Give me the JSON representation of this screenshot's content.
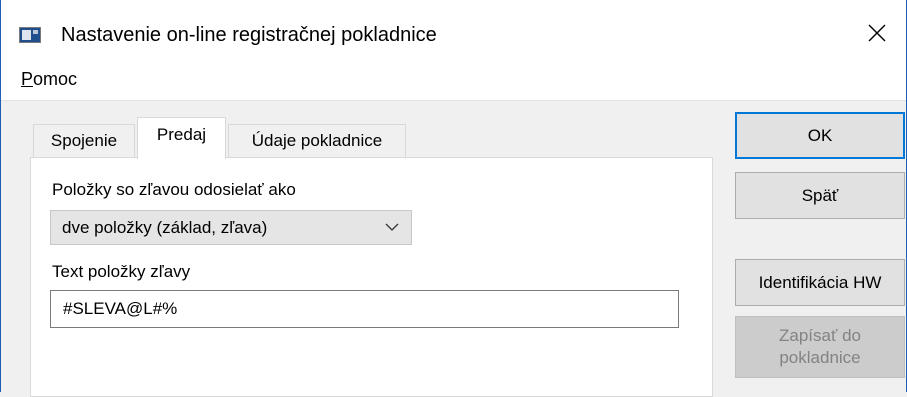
{
  "window": {
    "title": "Nastavenie on-line registračnej pokladnice"
  },
  "menu": {
    "items": [
      {
        "mnemonic": "P",
        "rest": "omoc"
      }
    ]
  },
  "tabs": [
    {
      "label": "Spojenie",
      "selected": false
    },
    {
      "label": "Predaj",
      "selected": true
    },
    {
      "label": "Údaje pokladnice",
      "selected": false
    }
  ],
  "panel": {
    "discount_mode_label": "Položky so zľavou odosielať ako",
    "discount_mode_value": "dve položky (základ, zľava)",
    "discount_text_label": "Text položky zľavy",
    "discount_text_value": "#SLEVA@L#%"
  },
  "buttons": {
    "ok": "OK",
    "back": "Späť",
    "identify_hw": "Identifikácia HW",
    "write_to_register": "Zapísať do\npokladnice"
  },
  "colors": {
    "focus_accent": "#0078d7",
    "window_border": "#1e5fb4",
    "disabled_text": "#838383"
  }
}
